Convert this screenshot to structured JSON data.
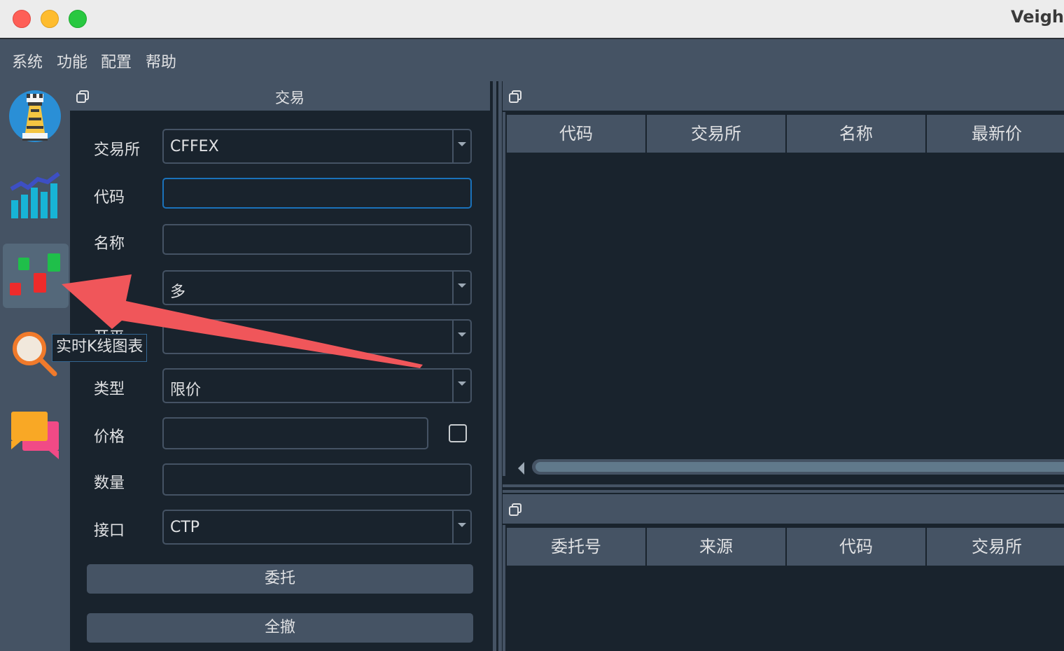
{
  "window": {
    "title": "Veigh"
  },
  "menu": {
    "items": [
      "系统",
      "功能",
      "配置",
      "帮助"
    ]
  },
  "toolbar": {
    "icons": [
      "chess-rook-icon",
      "trend-chart-icon",
      "candlestick-icon",
      "magnifier-icon",
      "chat-icon"
    ],
    "active_index": 2,
    "tooltip": "实时K线图表"
  },
  "trade_dock": {
    "title": "交易",
    "exchange_label": "交易所",
    "exchange_value": "CFFEX",
    "symbol_label": "代码",
    "symbol_value": "",
    "name_label": "名称",
    "name_value": "",
    "direction_value": "多",
    "offset_label": "开平",
    "offset_value": "",
    "type_label": "类型",
    "type_value": "限价",
    "price_label": "价格",
    "price_value": "",
    "volume_label": "数量",
    "volume_value": "",
    "gateway_label": "接口",
    "gateway_value": "CTP",
    "send_button": "委托",
    "cancel_all_button": "全撤"
  },
  "tick_monitor": {
    "headers": [
      "代码",
      "交易所",
      "名称",
      "最新价"
    ]
  },
  "order_monitor": {
    "headers": [
      "委托号",
      "来源",
      "代码",
      "交易所"
    ]
  },
  "colors": {
    "accent": "#1a72bb",
    "panel": "#455364",
    "background": "#19232d",
    "annotation_arrow": "#f0565a"
  }
}
